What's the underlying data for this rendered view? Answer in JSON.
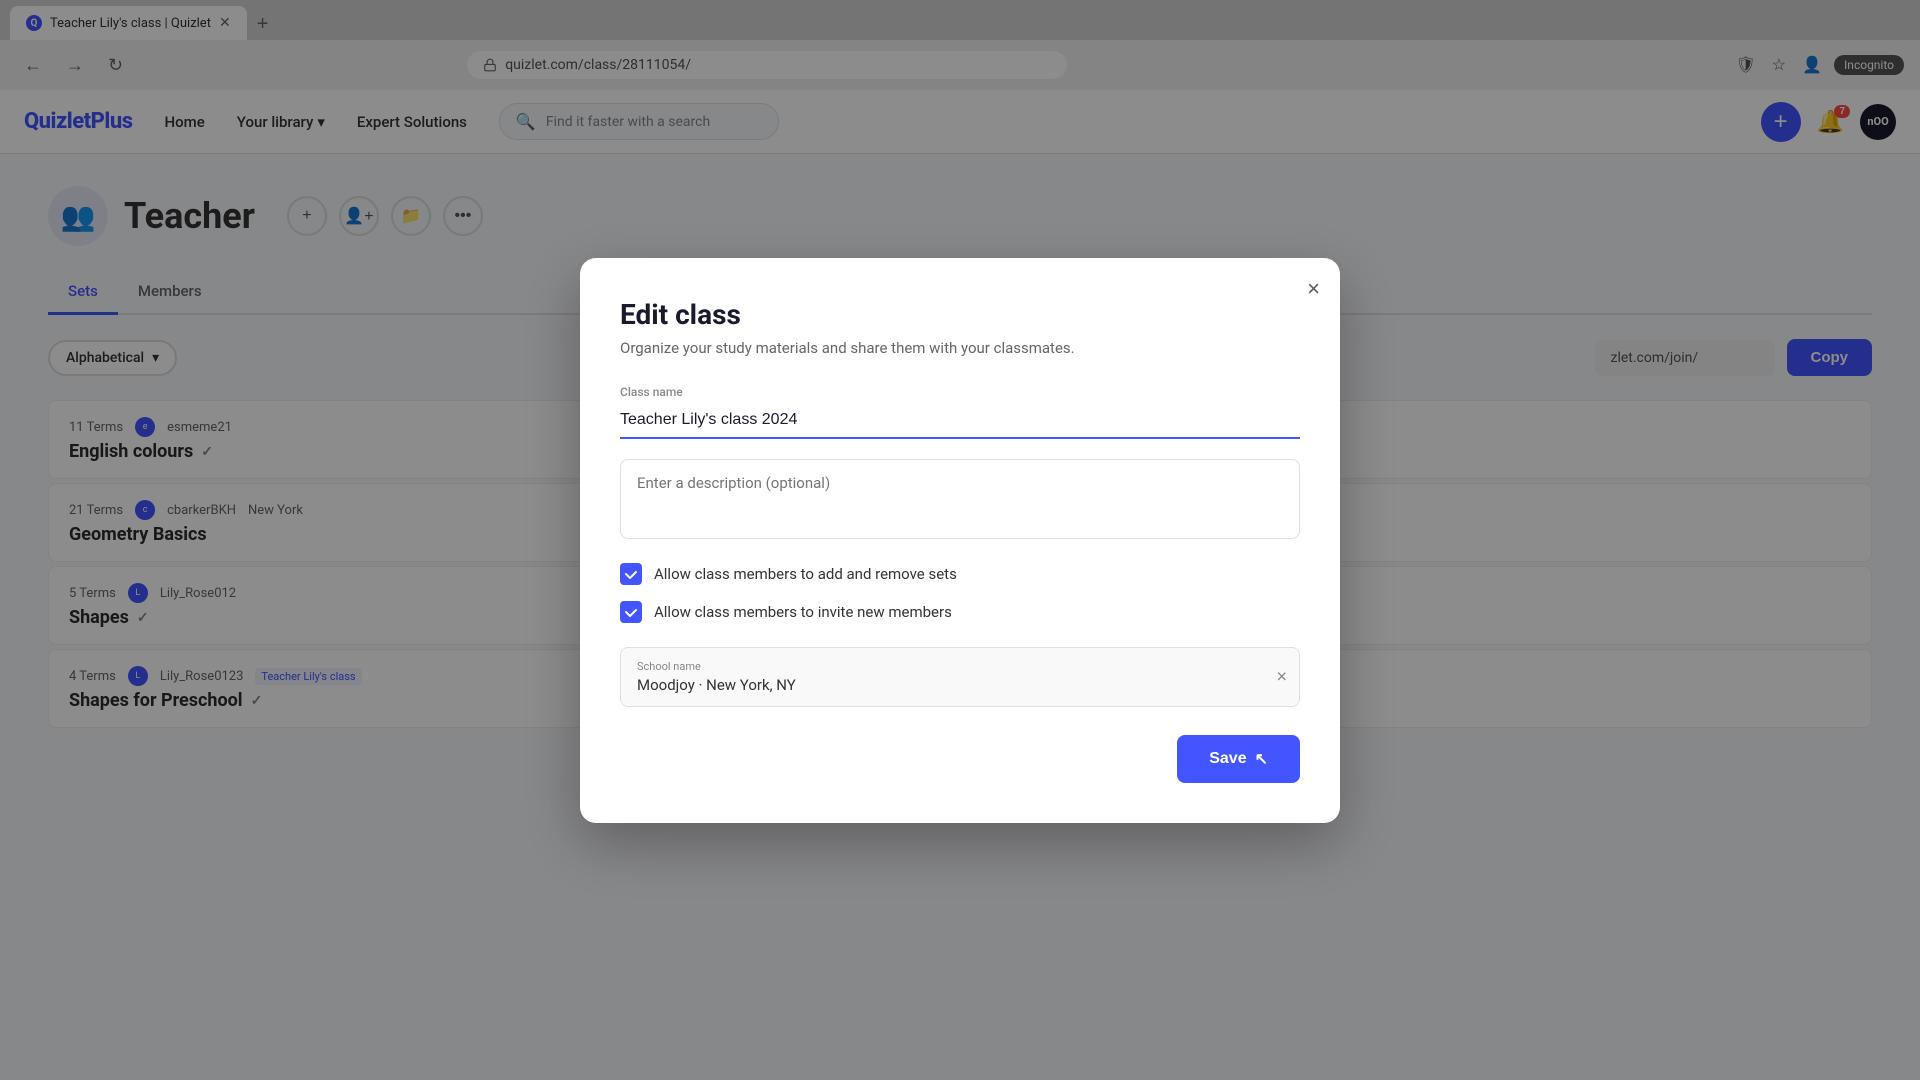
{
  "browser": {
    "tab_title": "Teacher Lily's class | Quizlet",
    "tab_new_label": "+",
    "address": "quizlet.com/class/28111054/",
    "back_label": "←",
    "forward_label": "→",
    "refresh_label": "↻",
    "incognito_label": "Incognito"
  },
  "header": {
    "logo": "QuizletPlus",
    "nav": {
      "home": "Home",
      "your_library": "Your library",
      "expert_solutions": "Expert Solutions"
    },
    "search_placeholder": "Find it faster with a search",
    "add_label": "+",
    "notification_count": "7",
    "avatar_text": "nOO"
  },
  "page": {
    "class_title": "Teacher",
    "class_icon": "👥",
    "tabs": [
      {
        "label": "Sets",
        "active": true
      },
      {
        "label": "Members",
        "active": false
      }
    ],
    "sort": {
      "label": "Alphabetical",
      "chevron": "▾"
    },
    "join_link": "zlet.com/join/",
    "copy_label": "Copy",
    "sets": [
      {
        "terms": "11 Terms",
        "user": "esmeme21",
        "name": "English colours",
        "verified": true
      },
      {
        "terms": "21 Terms",
        "user": "cbarkerBKH",
        "name": "Geometry Basics",
        "location": "New York",
        "verified": false
      },
      {
        "terms": "5 Terms",
        "user": "Lily_Rose012",
        "name": "Shapes",
        "verified": true
      },
      {
        "terms": "4 Terms",
        "user": "Lily_Rose0123",
        "class_tag": "Teacher Lily's class",
        "name": "Shapes for Preschool",
        "verified": true
      }
    ]
  },
  "modal": {
    "title": "Edit class",
    "subtitle": "Organize your study materials and share them with your classmates.",
    "class_name_label": "Class name",
    "class_name_value": "Teacher Lily's class 2024",
    "description_placeholder": "Enter a description (optional)",
    "checkboxes": [
      {
        "label": "Allow class members to add and remove sets",
        "checked": true
      },
      {
        "label": "Allow class members to invite new members",
        "checked": true
      }
    ],
    "school_label": "School name",
    "school_value": "Moodjoy · New York, NY",
    "save_label": "Save",
    "close_label": "×"
  }
}
